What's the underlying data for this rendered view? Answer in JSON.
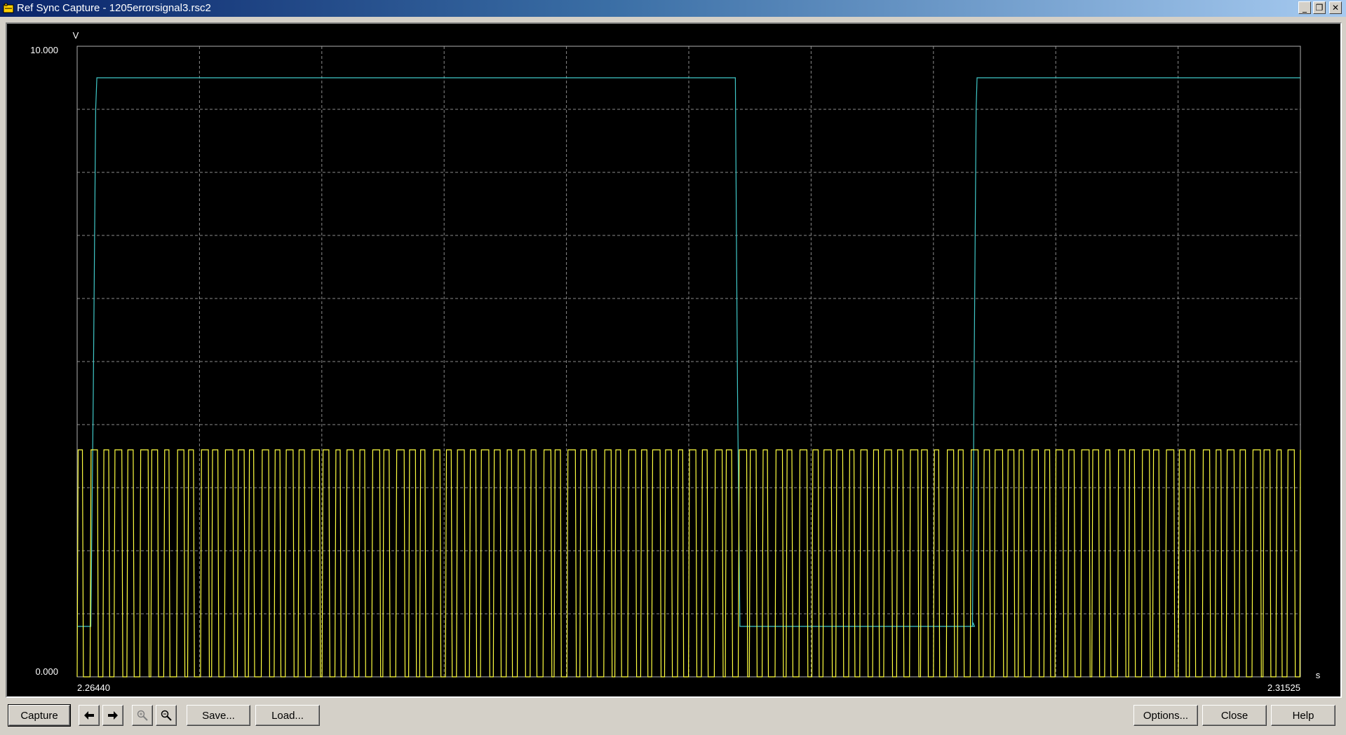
{
  "window": {
    "title": "Ref Sync Capture - 1205errorsignal3.rsc2",
    "minimize_glyph": "_",
    "maximize_glyph": "❐",
    "close_glyph": "✕"
  },
  "toolbar": {
    "capture_label": "Capture",
    "back_icon": "arrow-left-icon",
    "forward_icon": "arrow-right-icon",
    "zoom_in_icon": "zoom-in-icon",
    "zoom_out_icon": "zoom-out-icon",
    "zoom_in_disabled": true,
    "save_label": "Save...",
    "load_label": "Load...",
    "options_label": "Options...",
    "close_label": "Close",
    "help_label": "Help"
  },
  "chart_data": {
    "type": "line",
    "title": "",
    "xlabel": "s",
    "ylabel": "V",
    "xlim": [
      2.2644,
      2.31525
    ],
    "ylim": [
      0.0,
      10.0
    ],
    "x_ticks_labels": [
      "2.26440",
      "2.31525"
    ],
    "y_ticks_labels": [
      "10.000",
      "0.000"
    ],
    "grid": true,
    "background": "#000000",
    "grid_color": "#8a8a8a",
    "axis_color": "#b0b0b0",
    "series": [
      {
        "color": "#40c8c8",
        "points": [
          [
            2.2644,
            0.8
          ],
          [
            2.26497,
            0.8
          ],
          [
            2.26507,
            4.5
          ],
          [
            2.26517,
            9.0
          ],
          [
            2.26522,
            9.5
          ],
          [
            2.29176,
            9.5
          ],
          [
            2.29185,
            4.5
          ],
          [
            2.29195,
            0.8
          ],
          [
            2.3016,
            0.8
          ],
          [
            2.30165,
            0.85
          ],
          [
            2.3017,
            0.8
          ],
          [
            2.30162,
            0.8
          ],
          [
            2.30168,
            4.5
          ],
          [
            2.30177,
            9.0
          ],
          [
            2.30181,
            9.5
          ],
          [
            2.31525,
            9.5
          ]
        ]
      },
      {
        "color": "#ffff40",
        "waveform": "pulse-train",
        "low": 0.0,
        "high": 3.6,
        "period": 0.000508,
        "start": 2.2644,
        "end": 2.31525
      }
    ]
  }
}
